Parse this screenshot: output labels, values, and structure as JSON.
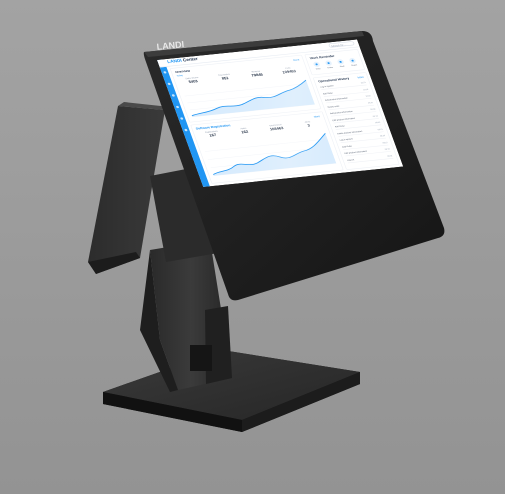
{
  "device": {
    "logo_text": "LANDI",
    "colors": {
      "backdrop": "#9b9b9b",
      "body": "#2d2d2d",
      "body_highlight": "#4a4a4a",
      "bezel": "#1b1b1b",
      "screen_accent": "#2196f3"
    }
  },
  "screen": {
    "app_title_accent": "LANDI",
    "app_title_rest": "Center",
    "search_placeholder": "Search for...",
    "overview": {
      "title": "Overview",
      "link": "More",
      "subtab": "Today",
      "stats": [
        {
          "label": "Sales Volume",
          "value": "5403"
        },
        {
          "label": "Total Orders",
          "value": "851"
        },
        {
          "label": "Revenue",
          "value": "79846"
        },
        {
          "label": "Profit",
          "value": "109463"
        }
      ]
    },
    "second": {
      "title": "Software Registration",
      "link": "More",
      "stats": [
        {
          "label": "Registrations",
          "value": "167"
        },
        {
          "label": "Active",
          "value": "162"
        },
        {
          "label": "Total Amount",
          "value": "108463"
        },
        {
          "label": "Alerts",
          "value": "3"
        }
      ]
    },
    "quick_access": {
      "title": "Work Reminder",
      "items": [
        "Sales",
        "Orders",
        "Stock",
        "Report"
      ]
    },
    "operations": {
      "title": "Operational History",
      "link": "More",
      "rows": [
        {
          "text": "Log in system",
          "time": "10:21"
        },
        {
          "text": "Add Order",
          "time": "10:18"
        },
        {
          "text": "Edit product information",
          "time": "10:02"
        },
        {
          "text": "Delete order",
          "time": "09:47"
        },
        {
          "text": "Add product information",
          "time": "09:30"
        },
        {
          "text": "Edit product information",
          "time": "09:12"
        },
        {
          "text": "Add Order",
          "time": "08:55"
        },
        {
          "text": "Delete product information",
          "time": "08:41"
        },
        {
          "text": "Log in system",
          "time": "08:30"
        },
        {
          "text": "Add Order",
          "time": "08:22"
        },
        {
          "text": "Edit product information",
          "time": "08:10"
        },
        {
          "text": "Log out",
          "time": "08:02"
        }
      ]
    }
  }
}
